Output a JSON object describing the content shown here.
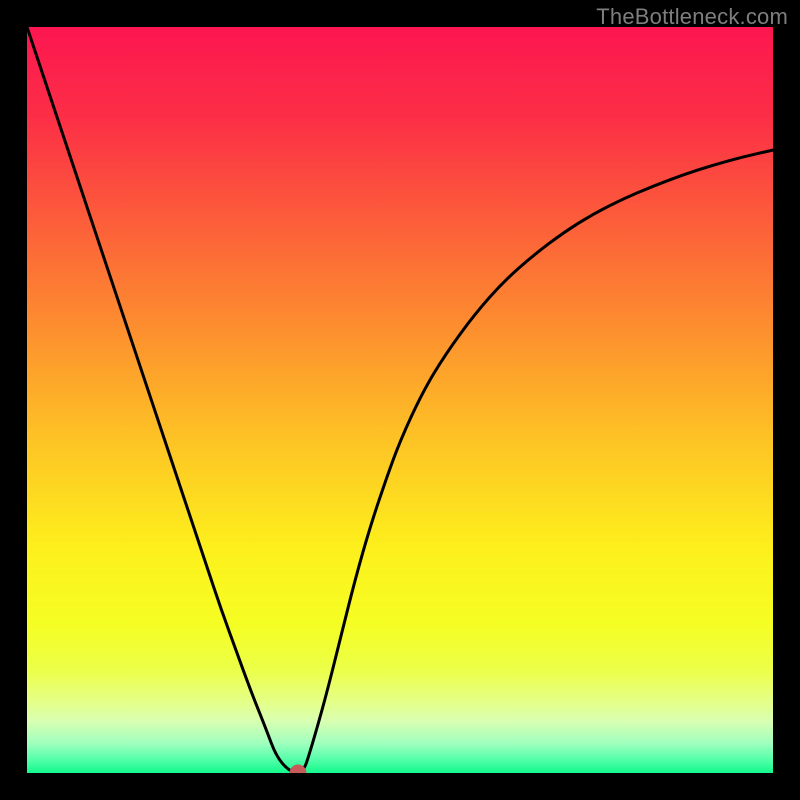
{
  "watermark": "TheBottleneck.com",
  "colors": {
    "frame": "#000000",
    "marker": "#c85a5a",
    "gradient_stops": [
      {
        "pct": 0,
        "color": "#fc1650"
      },
      {
        "pct": 12,
        "color": "#fc2e46"
      },
      {
        "pct": 25,
        "color": "#fc5a3b"
      },
      {
        "pct": 40,
        "color": "#fd8d2f"
      },
      {
        "pct": 55,
        "color": "#fdc225"
      },
      {
        "pct": 70,
        "color": "#fdf01c"
      },
      {
        "pct": 80,
        "color": "#f5fe23"
      },
      {
        "pct": 86,
        "color": "#ecff47"
      },
      {
        "pct": 90,
        "color": "#e6ff81"
      },
      {
        "pct": 93,
        "color": "#d9ffb1"
      },
      {
        "pct": 96,
        "color": "#a0ffbe"
      },
      {
        "pct": 98,
        "color": "#5bffac"
      },
      {
        "pct": 100,
        "color": "#13f98d"
      }
    ]
  },
  "chart_data": {
    "type": "line",
    "title": "",
    "xlabel": "",
    "ylabel": "",
    "xlim": [
      0,
      100
    ],
    "ylim": [
      0,
      100
    ],
    "grid": false,
    "legend": false,
    "series": [
      {
        "name": "bottleneck-curve",
        "x": [
          0,
          2,
          4,
          6,
          8,
          10,
          12,
          14,
          16,
          18,
          20,
          22,
          24,
          26,
          28,
          30,
          32,
          33.5,
          35.5,
          37,
          38,
          40,
          42,
          44,
          46,
          48,
          50,
          53,
          56,
          60,
          64,
          68,
          72,
          76,
          80,
          84,
          88,
          92,
          96,
          100
        ],
        "y": [
          100,
          94,
          88,
          82,
          76,
          70,
          64,
          58,
          52,
          46,
          40,
          34,
          28,
          22,
          16.5,
          11,
          6,
          2,
          0,
          0,
          3,
          10,
          18,
          26,
          33,
          39,
          44.5,
          51,
          56,
          61.5,
          66,
          69.5,
          72.5,
          75,
          77,
          78.7,
          80.2,
          81.5,
          82.6,
          83.5
        ]
      }
    ],
    "annotations": [
      {
        "name": "optimal-point",
        "x": 36.3,
        "y": 0
      }
    ]
  }
}
